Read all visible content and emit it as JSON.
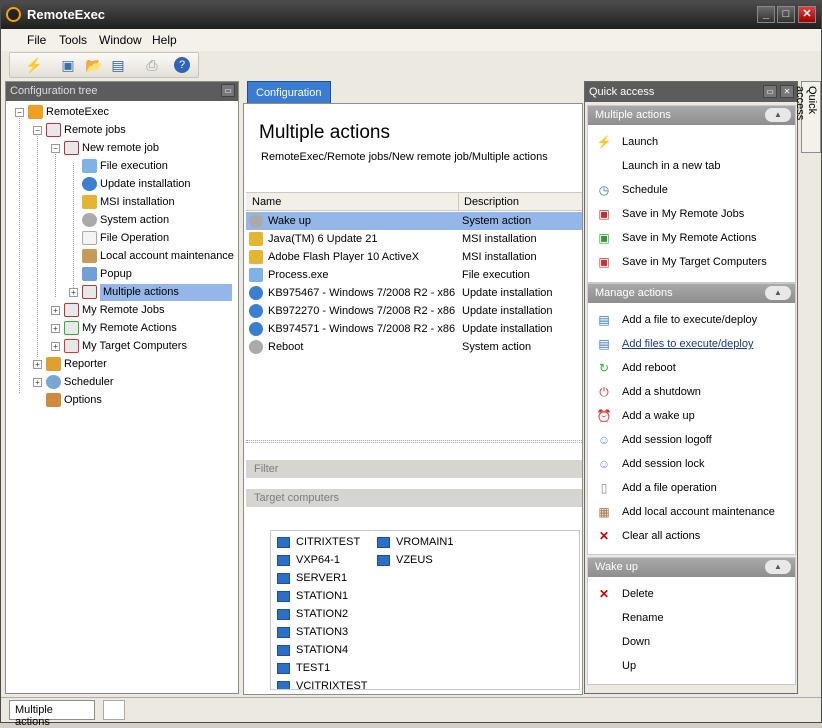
{
  "window": {
    "title": "RemoteExec"
  },
  "menu": [
    "File",
    "Tools",
    "Window",
    "Help"
  ],
  "config_tree": {
    "title": "Configuration tree",
    "nodes": [
      "RemoteExec",
      "Remote jobs",
      "New remote job",
      "File execution",
      "Update installation",
      "MSI installation",
      "System action",
      "File Operation",
      "Local account maintenance",
      "Popup",
      "Multiple actions",
      "My Remote Jobs",
      "My Remote Actions",
      "My Target Computers",
      "Reporter",
      "Scheduler",
      "Options"
    ]
  },
  "tab": {
    "label": "Configuration"
  },
  "main": {
    "heading": "Multiple actions",
    "breadcrumb": "RemoteExec/Remote jobs/New remote job/Multiple actions",
    "columns": [
      "Name",
      "Description"
    ],
    "rows": [
      {
        "name": "Wake up",
        "desc": "System action"
      },
      {
        "name": "Java(TM) 6 Update 21",
        "desc": "MSI installation"
      },
      {
        "name": "Adobe Flash Player 10 ActiveX",
        "desc": "MSI installation"
      },
      {
        "name": "Process.exe",
        "desc": "File execution"
      },
      {
        "name": "KB975467 - Windows 7/2008 R2 - x86",
        "desc": "Update installation"
      },
      {
        "name": "KB972270 - Windows 7/2008 R2 - x86",
        "desc": "Update installation"
      },
      {
        "name": "KB974571 - Windows 7/2008 R2 - x86",
        "desc": "Update installation"
      },
      {
        "name": "Reboot",
        "desc": "System action"
      }
    ],
    "filter_label": "Filter",
    "targets_label": "Target computers",
    "computers_col1": [
      "CITRIXTEST",
      "VXP64-1",
      "SERVER1",
      "STATION1",
      "STATION2",
      "STATION3",
      "STATION4",
      "TEST1",
      "VCITRIXTEST"
    ],
    "computers_col2": [
      "VROMAIN1",
      "VZEUS"
    ]
  },
  "quick_access": {
    "title": "Quick access",
    "side_tab": "Quick access",
    "multiple_actions": {
      "title": "Multiple actions",
      "items": [
        "Launch",
        "Launch in a new tab",
        "Schedule",
        "Save in My Remote Jobs",
        "Save in My Remote Actions",
        "Save in My Target Computers"
      ]
    },
    "manage_actions": {
      "title": "Manage actions",
      "items": [
        "Add a file to execute/deploy",
        "Add files to execute/deploy",
        "Add reboot",
        "Add a shutdown",
        "Add a wake up",
        "Add session logoff",
        "Add session lock",
        "Add a file operation",
        "Add local account maintenance",
        "Clear all actions"
      ]
    },
    "wake_up": {
      "title": "Wake up",
      "items": [
        "Delete",
        "Rename",
        "Down",
        "Up"
      ]
    }
  },
  "status": {
    "tab": "Multiple actions"
  }
}
